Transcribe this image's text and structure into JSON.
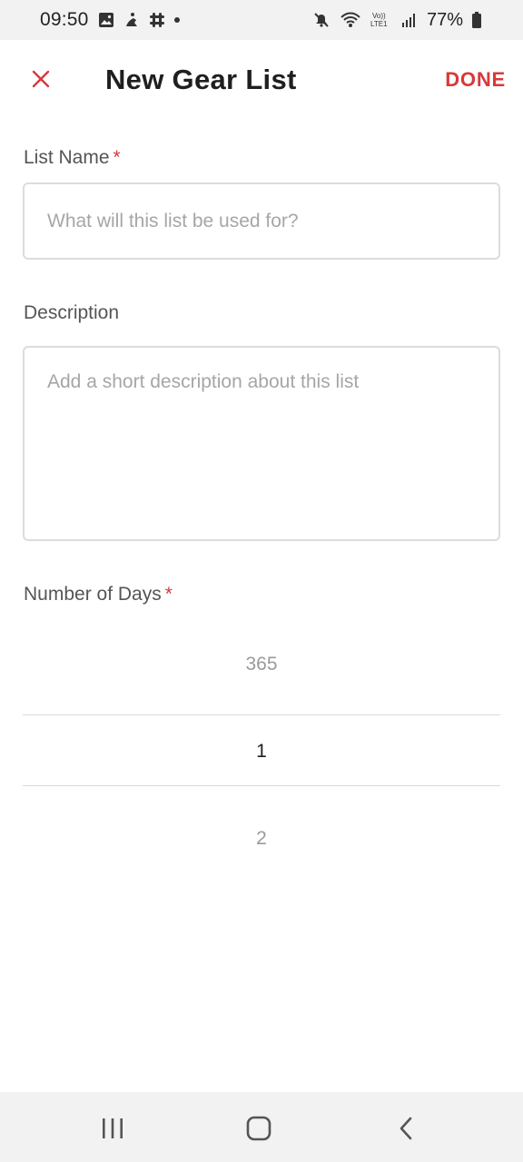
{
  "status_bar": {
    "time": "09:50",
    "battery": "77%",
    "left_icons": [
      "gallery-icon",
      "fitness-icon",
      "slack-icon",
      "notification-dot-icon"
    ],
    "right_icons": [
      "mute-icon",
      "wifi-icon",
      "volte-icon",
      "signal-icon",
      "battery-icon"
    ],
    "volte_text": "Vo)) LTE1"
  },
  "app_bar": {
    "title": "New Gear List",
    "done_label": "DONE",
    "close_icon": "close-icon"
  },
  "form": {
    "list_name": {
      "label": "List Name",
      "required_mark": "*",
      "placeholder": "What will this list be used for?",
      "value": ""
    },
    "description": {
      "label": "Description",
      "placeholder": "Add a short description about this list",
      "value": ""
    },
    "days": {
      "label": "Number of Days",
      "required_mark": "*",
      "picker": {
        "previous": "365",
        "selected": "1",
        "next": "2"
      }
    }
  },
  "nav_bar": {
    "icons": [
      "recents-icon",
      "home-icon",
      "back-icon"
    ]
  },
  "colors": {
    "accent": "#d9383a",
    "placeholder": "#a6a6a6",
    "border": "#dcdcdc",
    "system_bar": "#f2f2f2"
  }
}
